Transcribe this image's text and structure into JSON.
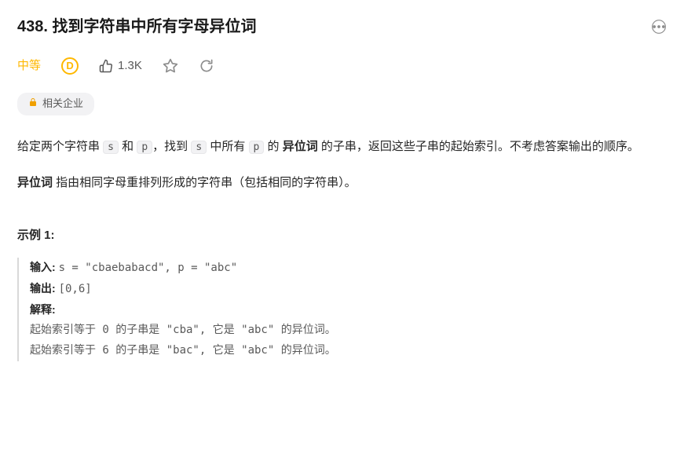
{
  "title": "438. 找到字符串中所有字母异位词",
  "difficulty": "中等",
  "hintBadge": "D",
  "likes": "1.3K",
  "companyTag": "相关企业",
  "desc": {
    "p1_a": "给定两个字符串 ",
    "s": "s",
    "p1_b": " 和 ",
    "p": "p",
    "p1_c": "，找到 ",
    "p1_d": " 中所有 ",
    "p1_e": " 的 ",
    "anagram": "异位词",
    "p1_f": " 的子串，返回这些子串的起始索引。不考虑答案输出的顺序。",
    "p2_a": "异位词 ",
    "p2_b": "指由相同字母重排列形成的字符串（包括相同的字符串）。"
  },
  "exampleHeading": "示例 1:",
  "example": {
    "inputLabel": "输入: ",
    "inputVal": "s = \"cbaebabacd\", p = \"abc\"",
    "outputLabel": "输出: ",
    "outputVal": "[0,6]",
    "explainLabel": "解释:",
    "explain1": "起始索引等于 0 的子串是 \"cba\", 它是 \"abc\" 的异位词。",
    "explain2": "起始索引等于 6 的子串是 \"bac\", 它是 \"abc\" 的异位词。"
  }
}
